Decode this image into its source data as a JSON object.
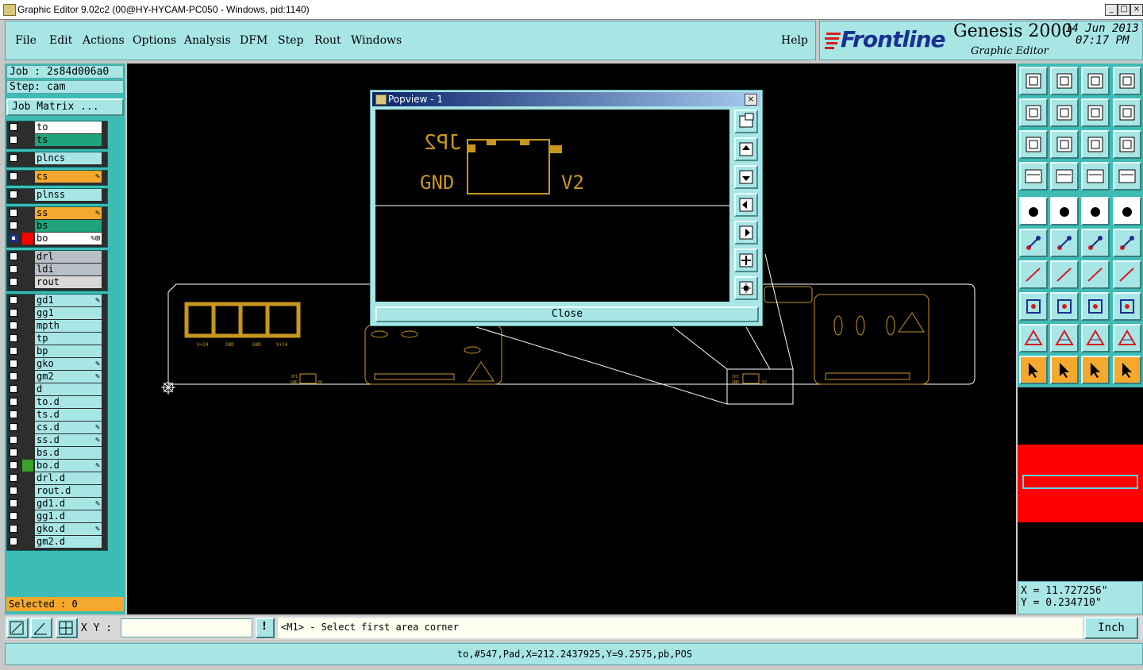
{
  "window": {
    "title": "Graphic Editor 9.02c2 (00@HY-HYCAM-PC050 - Windows, pid:1140)",
    "buttons": [
      "_",
      "□",
      "×"
    ]
  },
  "menu": {
    "items": [
      "File",
      "Edit",
      "Actions",
      "Options",
      "Analysis",
      "DFM",
      "Step",
      "Rout",
      "Windows"
    ],
    "help": "Help"
  },
  "brand": {
    "logo": "Frontline",
    "product": "Genesis 2000",
    "subtitle": "Graphic Editor",
    "date": "14 Jun 2013",
    "time": "07:17 PM"
  },
  "job": {
    "job_label": "Job : 2s84d006a0",
    "step_label": "Step: cam",
    "matrix_button": "Job Matrix ..."
  },
  "layers": [
    {
      "name": "to",
      "bg": "#ffffff",
      "swatch": "#2d2d2d"
    },
    {
      "name": "ts",
      "bg": "#1fa37a",
      "swatch": "#2d2d2d"
    },
    {
      "name": "plncs",
      "bg": "#a8e6e6",
      "swatch": "#2d2d2d"
    },
    {
      "name": "cs",
      "bg": "#f4a92e",
      "swatch": "#2d2d2d",
      "mark": "✎"
    },
    {
      "name": "plnss",
      "bg": "#a8e6e6",
      "swatch": "#2d2d2d"
    },
    {
      "name": "ss",
      "bg": "#f4a92e",
      "swatch": "#2d2d2d",
      "mark": "✎"
    },
    {
      "name": "bs",
      "bg": "#1fa37a",
      "swatch": "#2d2d2d"
    },
    {
      "name": "bo",
      "bg": "#ffffff",
      "swatch": "#ff0000",
      "mark": "✎⊞",
      "active": true
    },
    {
      "name": "drl",
      "bg": "#b8bfc6",
      "swatch": "#2d2d2d"
    },
    {
      "name": "ldi",
      "bg": "#b8bfc6",
      "swatch": "#2d2d2d"
    },
    {
      "name": "rout",
      "bg": "#d8d8d8",
      "swatch": "#2d2d2d"
    },
    {
      "name": "gd1",
      "bg": "#a8e6e6",
      "swatch": "#2d2d2d",
      "mark": "✎"
    },
    {
      "name": "gg1",
      "bg": "#a8e6e6",
      "swatch": "#2d2d2d"
    },
    {
      "name": "mpth",
      "bg": "#a8e6e6",
      "swatch": "#2d2d2d"
    },
    {
      "name": "tp",
      "bg": "#a8e6e6",
      "swatch": "#2d2d2d"
    },
    {
      "name": "bp",
      "bg": "#a8e6e6",
      "swatch": "#2d2d2d"
    },
    {
      "name": "gko",
      "bg": "#a8e6e6",
      "swatch": "#2d2d2d",
      "mark": "✎"
    },
    {
      "name": "gm2",
      "bg": "#a8e6e6",
      "swatch": "#2d2d2d",
      "mark": "✎"
    },
    {
      "name": "d",
      "bg": "#a8e6e6",
      "swatch": "#2d2d2d"
    },
    {
      "name": "to.d",
      "bg": "#a8e6e6",
      "swatch": "#2d2d2d"
    },
    {
      "name": "ts.d",
      "bg": "#a8e6e6",
      "swatch": "#2d2d2d"
    },
    {
      "name": "cs.d",
      "bg": "#a8e6e6",
      "swatch": "#2d2d2d",
      "mark": "✎"
    },
    {
      "name": "ss.d",
      "bg": "#a8e6e6",
      "swatch": "#2d2d2d",
      "mark": "✎"
    },
    {
      "name": "bs.d",
      "bg": "#a8e6e6",
      "swatch": "#2d2d2d"
    },
    {
      "name": "bo.d",
      "bg": "#a8e6e6",
      "swatch": "#39a02a",
      "mark": "✎"
    },
    {
      "name": "drl.d",
      "bg": "#a8e6e6",
      "swatch": "#2d2d2d"
    },
    {
      "name": "rout.d",
      "bg": "#a8e6e6",
      "swatch": "#2d2d2d"
    },
    {
      "name": "gd1.d",
      "bg": "#a8e6e6",
      "swatch": "#2d2d2d",
      "mark": "✎"
    },
    {
      "name": "gg1.d",
      "bg": "#a8e6e6",
      "swatch": "#2d2d2d"
    },
    {
      "name": "gko.d",
      "bg": "#a8e6e6",
      "swatch": "#2d2d2d",
      "mark": "✎"
    },
    {
      "name": "gm2.d",
      "bg": "#a8e6e6",
      "swatch": "#2d2d2d"
    }
  ],
  "selected": "Selected : 0",
  "popview": {
    "title": "Popview - 1",
    "close_label": "Close",
    "texts": {
      "ref": "JP2",
      "gnd": "GND",
      "v2": "V2"
    },
    "side_buttons": [
      "popview-zoom-icon",
      "popview-pan-up-icon",
      "popview-pan-down-icon",
      "popview-pan-left-icon",
      "popview-pan-right-icon",
      "popview-zoom-in-icon",
      "popview-zoom-out-icon"
    ]
  },
  "board": {
    "pad_labels": [
      "V+24",
      "GND",
      "GND",
      "V+24"
    ],
    "small_labels": [
      "JP1",
      "GND",
      "V0",
      "JP2",
      "GND",
      "V2"
    ]
  },
  "toolbar_icons": [
    "open-icon",
    "save-icon",
    "home-icon",
    "window-icon",
    "prev-icon",
    "next-icon",
    "undo-icon",
    "redo-icon",
    "fit-icon",
    "center-icon",
    "scale-1-2-icon",
    "help-icon",
    "measure-icon",
    "grid-icon",
    "layer-tool-icon",
    "layer-tool-2-icon",
    "pad-icon",
    "color-icon",
    "ruler-icon",
    "dot-icon",
    "node-icon",
    "cross-icon",
    "connect-icon",
    "connect-2-icon",
    "line-icon",
    "slash-icon",
    "arc-icon",
    "split-icon",
    "snap-icon",
    "minus-icon",
    "zoom-box-icon",
    "shapes-icon",
    "triangle-icon",
    "triangle-2-icon",
    "triangle-3-icon",
    "triangle-4-icon",
    "pointer-icon",
    "pointer-2-icon",
    "pointer-3-icon",
    "route-icon"
  ],
  "coords": {
    "x": "X = 11.727256\"",
    "y": "Y = 0.234710\""
  },
  "cmd": {
    "xy_label": "X Y :",
    "xy_value": "",
    "message": "<M1> - Select first area corner",
    "units": "Inch"
  },
  "status": "to,#547,Pad,X=212.2437925,Y=9.2575,pb,POS",
  "colors": {
    "panel": "#a8e6e6",
    "teal": "#3cbcb4",
    "gold": "#c8961e",
    "orange": "#f4a92e"
  }
}
